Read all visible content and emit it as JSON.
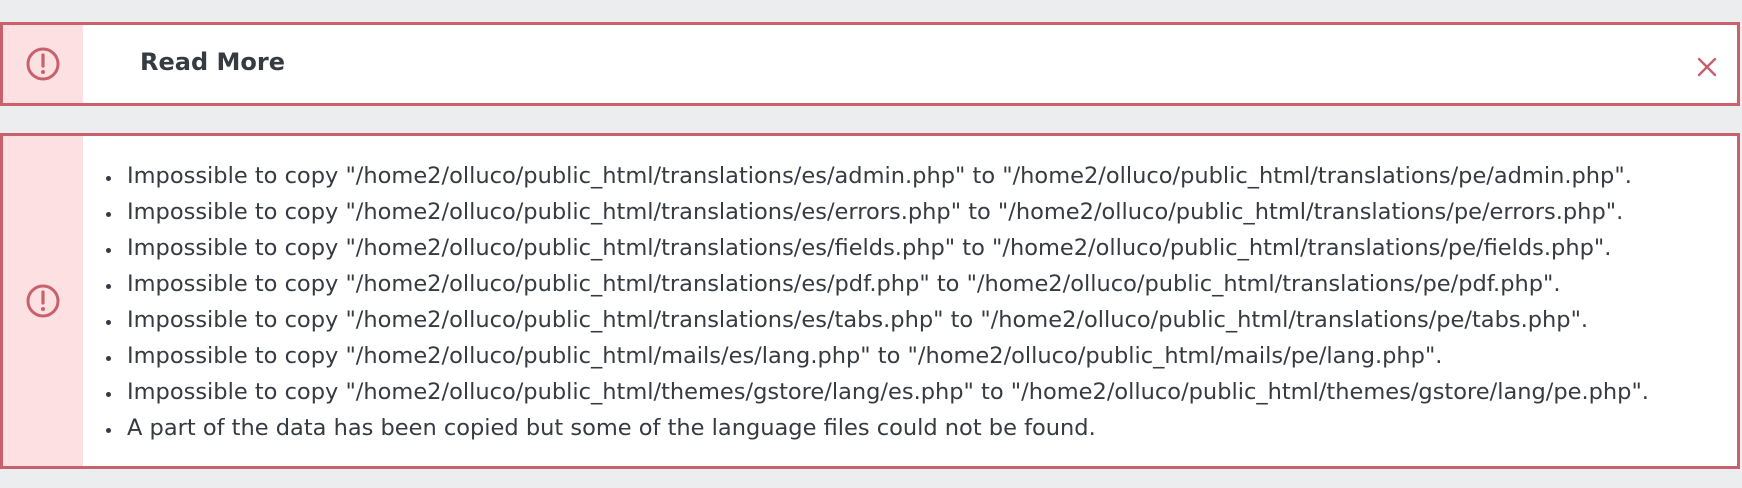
{
  "colors": {
    "page_background": "#ebedee",
    "alert_border": "#c8616c",
    "icon_column": "#fce0e2",
    "icon": "#c8616c",
    "text": "#363a41"
  },
  "top_alert": {
    "icon": "alert-circle-icon",
    "title": "Read More",
    "close_icon": "close-icon"
  },
  "error_alert": {
    "icon": "alert-circle-icon",
    "messages": [
      "Impossible to copy \"/home2/olluco/public_html/translations/es/admin.php\" to \"/home2/olluco/public_html/translations/pe/admin.php\".",
      "Impossible to copy \"/home2/olluco/public_html/translations/es/errors.php\" to \"/home2/olluco/public_html/translations/pe/errors.php\".",
      "Impossible to copy \"/home2/olluco/public_html/translations/es/fields.php\" to \"/home2/olluco/public_html/translations/pe/fields.php\".",
      "Impossible to copy \"/home2/olluco/public_html/translations/es/pdf.php\" to \"/home2/olluco/public_html/translations/pe/pdf.php\".",
      "Impossible to copy \"/home2/olluco/public_html/translations/es/tabs.php\" to \"/home2/olluco/public_html/translations/pe/tabs.php\".",
      "Impossible to copy \"/home2/olluco/public_html/mails/es/lang.php\" to \"/home2/olluco/public_html/mails/pe/lang.php\".",
      "Impossible to copy \"/home2/olluco/public_html/themes/gstore/lang/es.php\" to \"/home2/olluco/public_html/themes/gstore/lang/pe.php\".",
      "A part of the data has been copied but some of the language files could not be found."
    ]
  }
}
